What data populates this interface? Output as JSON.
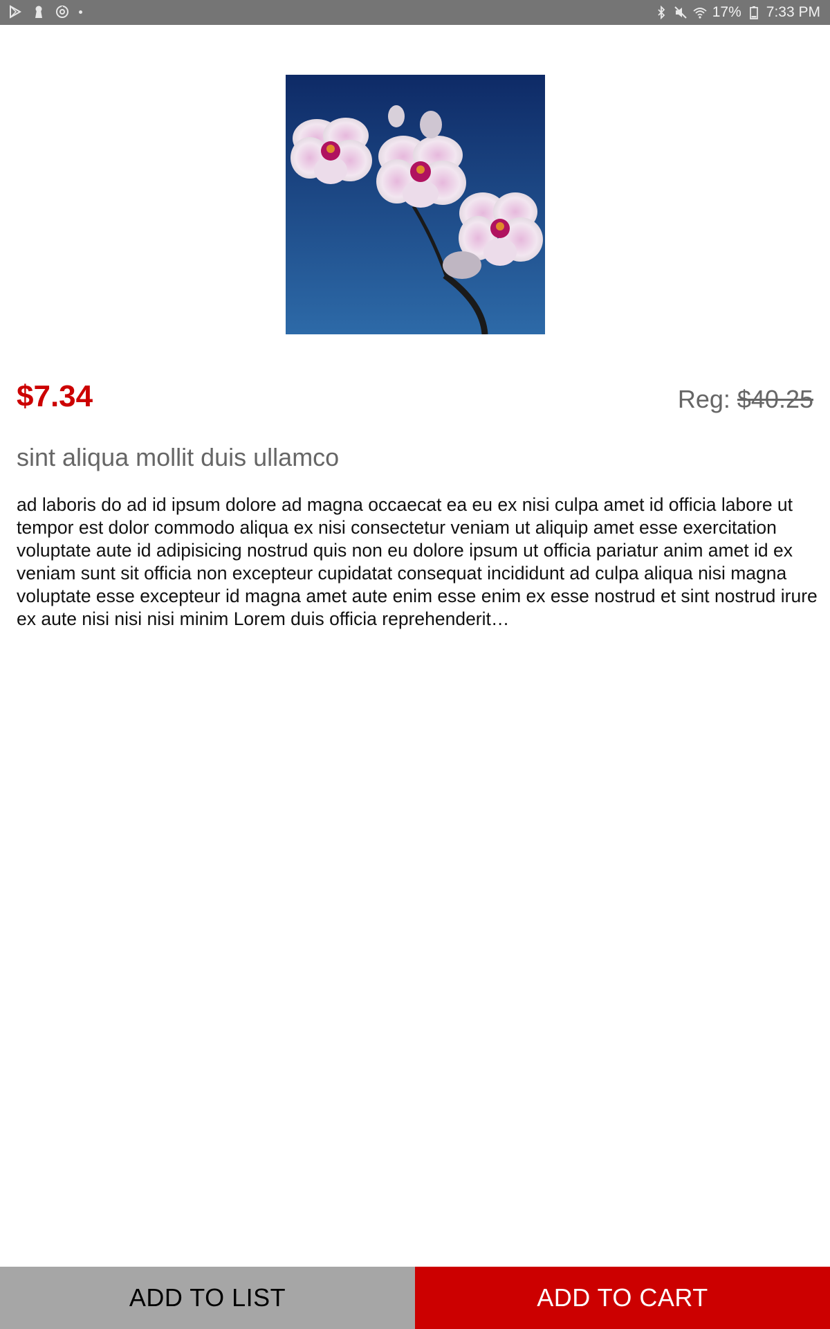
{
  "status_bar": {
    "left_icons": [
      "play-store-icon",
      "keyhole-icon",
      "sync-icon",
      "dot-icon"
    ],
    "right_icons": [
      "bluetooth-icon",
      "mute-icon",
      "wifi-icon"
    ],
    "battery_percent": "17%",
    "battery_icon": "battery-icon",
    "time": "7:33 PM"
  },
  "product": {
    "image_icon": "orchid-photo",
    "price": "$7.34",
    "reg_label": "Reg:",
    "reg_price": "$40.25",
    "title": "sint aliqua mollit duis ullamco",
    "description": "ad laboris do ad id ipsum dolore ad magna occaecat ea eu ex nisi culpa amet id officia labore ut tempor est dolor commodo aliqua ex nisi consectetur veniam ut aliquip amet esse exercitation voluptate aute id adipisicing nostrud quis non eu dolore ipsum ut officia pariatur anim amet id ex veniam sunt sit officia non excepteur cupidatat consequat incididunt ad culpa aliqua nisi magna voluptate esse excepteur id magna amet aute enim esse enim ex esse nostrud et sint nostrud irure ex aute nisi nisi nisi minim Lorem duis officia reprehenderit…"
  },
  "actions": {
    "add_to_list": "ADD TO LIST",
    "add_to_cart": "ADD TO CART"
  },
  "colors": {
    "accent": "#cc0000",
    "status_bar": "#757575",
    "list_button": "#a6a6a6"
  }
}
